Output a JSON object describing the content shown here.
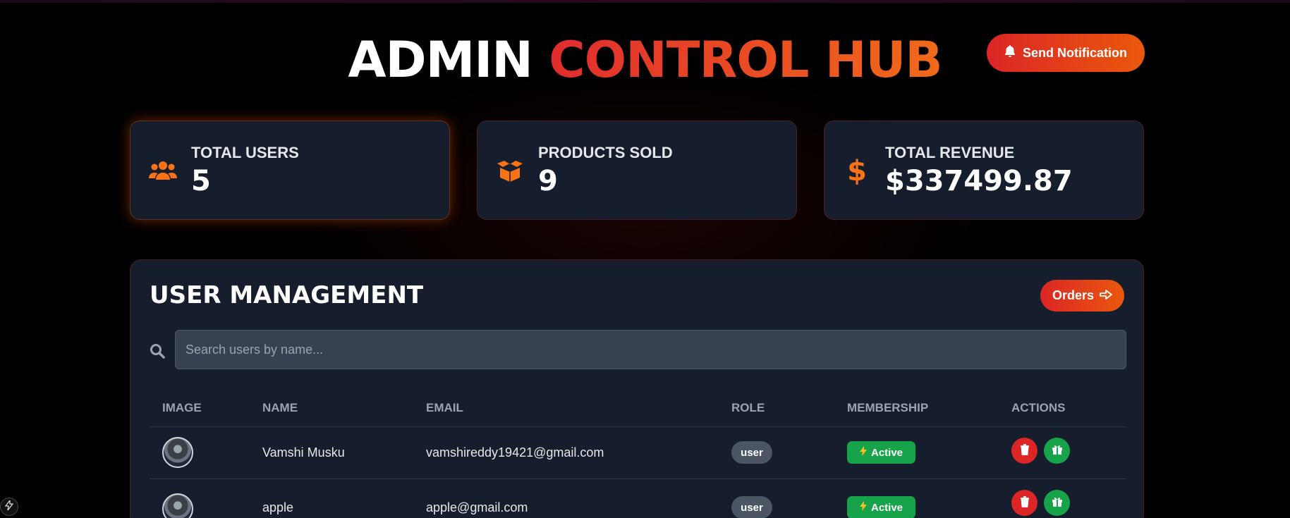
{
  "header": {
    "title_white": "ADMIN",
    "title_red": "CONTROL HUB",
    "notify_label": "Send Notification"
  },
  "stats": [
    {
      "label": "TOTAL USERS",
      "value": "5",
      "icon": "users-icon"
    },
    {
      "label": "PRODUCTS SOLD",
      "value": "9",
      "icon": "box-open-icon"
    },
    {
      "label": "TOTAL REVENUE",
      "value": "$337499.87",
      "icon": "dollar-icon"
    }
  ],
  "panel": {
    "title": "USER MANAGEMENT",
    "orders_label": "Orders",
    "search_placeholder": "Search users by name..."
  },
  "table": {
    "columns": [
      "IMAGE",
      "NAME",
      "EMAIL",
      "ROLE",
      "MEMBERSHIP",
      "ACTIONS"
    ],
    "rows": [
      {
        "name": "Vamshi Musku",
        "email": "vamshireddy19421@gmail.com",
        "role": "user",
        "membership": "Active"
      },
      {
        "name": "apple",
        "email": "apple@gmail.com",
        "role": "user",
        "membership": "Active"
      }
    ]
  },
  "colors": {
    "accent_red": "#dc2626",
    "accent_orange": "#ea580c",
    "card_bg": "#161e2d",
    "success_green": "#16a34a"
  }
}
